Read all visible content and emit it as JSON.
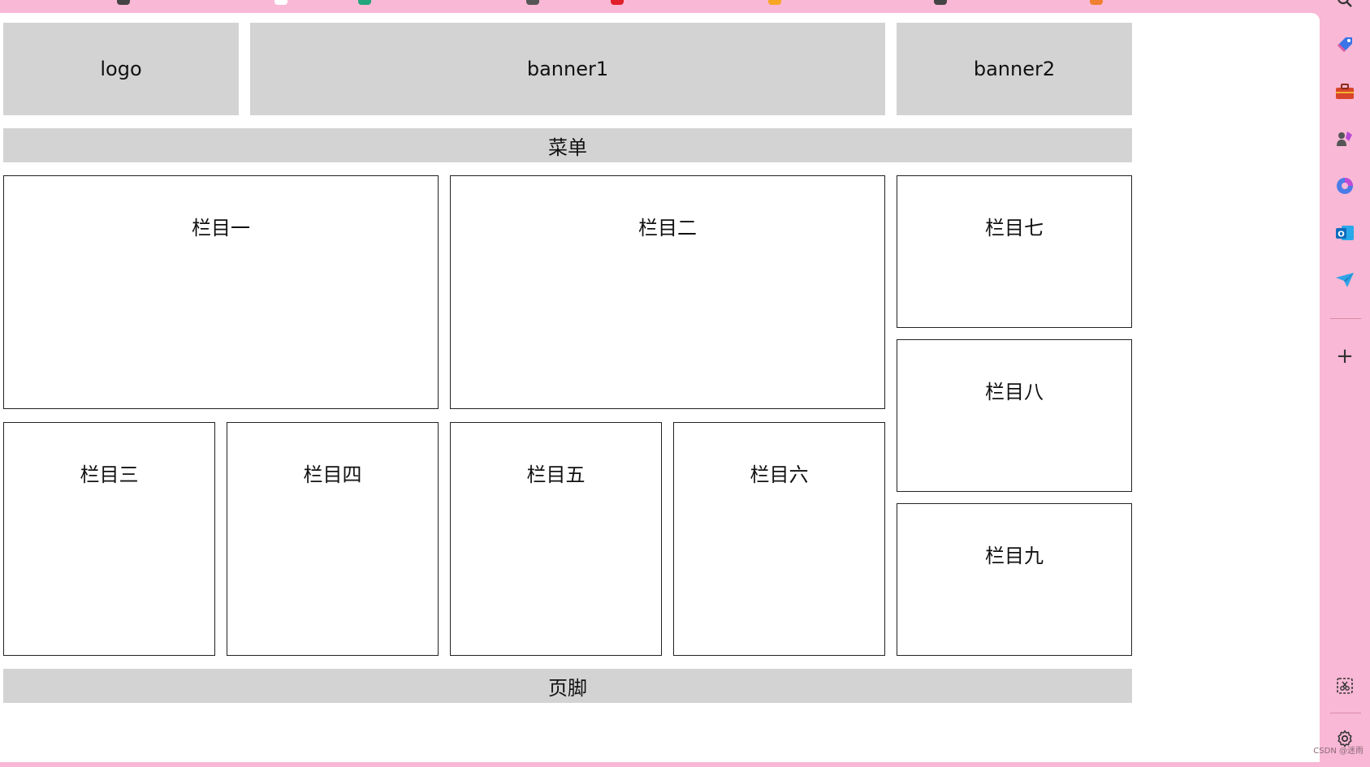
{
  "header": {
    "logo": "logo",
    "banner1": "banner1",
    "banner2": "banner2"
  },
  "menu": {
    "label": "菜单"
  },
  "columns": {
    "c1": "栏目一",
    "c2": "栏目二",
    "c3": "栏目三",
    "c4": "栏目四",
    "c5": "栏目五",
    "c6": "栏目六",
    "c7": "栏目七",
    "c8": "栏目八",
    "c9": "栏目九"
  },
  "footer": {
    "label": "页脚"
  },
  "sidebar": {
    "icons": [
      "tag-icon",
      "toolbox-icon",
      "games-icon",
      "copilot-icon",
      "outlook-icon",
      "send-icon"
    ],
    "add_symbol": "+",
    "bottom_icons": [
      "screenshot-icon",
      "settings-icon"
    ]
  },
  "watermark": "CSDN @迷雨",
  "colors": {
    "accent_pink": "#f9b8d5",
    "block_grey": "#d3d3d3"
  }
}
